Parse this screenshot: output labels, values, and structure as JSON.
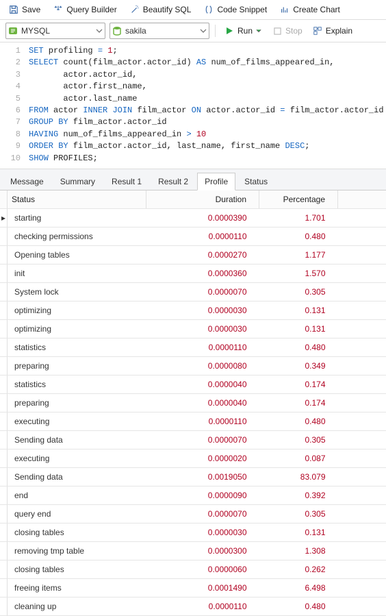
{
  "toolbar": {
    "save": "Save",
    "query_builder": "Query Builder",
    "beautify": "Beautify SQL",
    "code_snippet": "Code Snippet",
    "create_chart": "Create Chart",
    "run": "Run",
    "stop": "Stop",
    "explain": "Explain"
  },
  "combo": {
    "conn": "MYSQL",
    "db": "sakila"
  },
  "sql_tokens": [
    [
      [
        "kw",
        "SET"
      ],
      [
        "ident",
        " profiling "
      ],
      [
        "kw",
        "="
      ],
      [
        "ident",
        " "
      ],
      [
        "num",
        "1"
      ],
      [
        "ident",
        ";"
      ]
    ],
    [
      [
        "kw",
        "SELECT"
      ],
      [
        "ident",
        " count(film_actor.actor_id) "
      ],
      [
        "kw",
        "AS"
      ],
      [
        "ident",
        " num_of_films_appeared_in,"
      ]
    ],
    [
      [
        "ident",
        "       actor.actor_id,"
      ]
    ],
    [
      [
        "ident",
        "       actor.first_name,"
      ]
    ],
    [
      [
        "ident",
        "       actor.last_name"
      ]
    ],
    [
      [
        "kw",
        "FROM"
      ],
      [
        "ident",
        " actor "
      ],
      [
        "kw",
        "INNER JOIN"
      ],
      [
        "ident",
        " film_actor "
      ],
      [
        "kw",
        "ON"
      ],
      [
        "ident",
        " actor.actor_id "
      ],
      [
        "kw",
        "="
      ],
      [
        "ident",
        " film_actor.actor_id"
      ]
    ],
    [
      [
        "kw",
        "GROUP BY"
      ],
      [
        "ident",
        " film_actor.actor_id"
      ]
    ],
    [
      [
        "kw",
        "HAVING"
      ],
      [
        "ident",
        " num_of_films_appeared_in "
      ],
      [
        "kw",
        ">"
      ],
      [
        "ident",
        " "
      ],
      [
        "num",
        "10"
      ]
    ],
    [
      [
        "kw",
        "ORDER BY"
      ],
      [
        "ident",
        " film_actor.actor_id, last_name, first_name "
      ],
      [
        "kw",
        "DESC"
      ],
      [
        "ident",
        ";"
      ]
    ],
    [
      [
        "kw",
        "SHOW"
      ],
      [
        "ident",
        " PROFILES;"
      ]
    ]
  ],
  "tabs": [
    "Message",
    "Summary",
    "Result 1",
    "Result 2",
    "Profile",
    "Status"
  ],
  "active_tab": 4,
  "grid": {
    "headers": [
      "Status",
      "Duration",
      "Percentage"
    ],
    "selected_row": 0,
    "rows": [
      [
        "starting",
        "0.0000390",
        "1.701"
      ],
      [
        "checking permissions",
        "0.0000110",
        "0.480"
      ],
      [
        "Opening tables",
        "0.0000270",
        "1.177"
      ],
      [
        "init",
        "0.0000360",
        "1.570"
      ],
      [
        "System lock",
        "0.0000070",
        "0.305"
      ],
      [
        "optimizing",
        "0.0000030",
        "0.131"
      ],
      [
        "optimizing",
        "0.0000030",
        "0.131"
      ],
      [
        "statistics",
        "0.0000110",
        "0.480"
      ],
      [
        "preparing",
        "0.0000080",
        "0.349"
      ],
      [
        "statistics",
        "0.0000040",
        "0.174"
      ],
      [
        "preparing",
        "0.0000040",
        "0.174"
      ],
      [
        "executing",
        "0.0000110",
        "0.480"
      ],
      [
        "Sending data",
        "0.0000070",
        "0.305"
      ],
      [
        "executing",
        "0.0000020",
        "0.087"
      ],
      [
        "Sending data",
        "0.0019050",
        "83.079"
      ],
      [
        "end",
        "0.0000090",
        "0.392"
      ],
      [
        "query end",
        "0.0000070",
        "0.305"
      ],
      [
        "closing tables",
        "0.0000030",
        "0.131"
      ],
      [
        "removing tmp table",
        "0.0000300",
        "1.308"
      ],
      [
        "closing tables",
        "0.0000060",
        "0.262"
      ],
      [
        "freeing items",
        "0.0001490",
        "6.498"
      ],
      [
        "cleaning up",
        "0.0000110",
        "0.480"
      ]
    ]
  }
}
